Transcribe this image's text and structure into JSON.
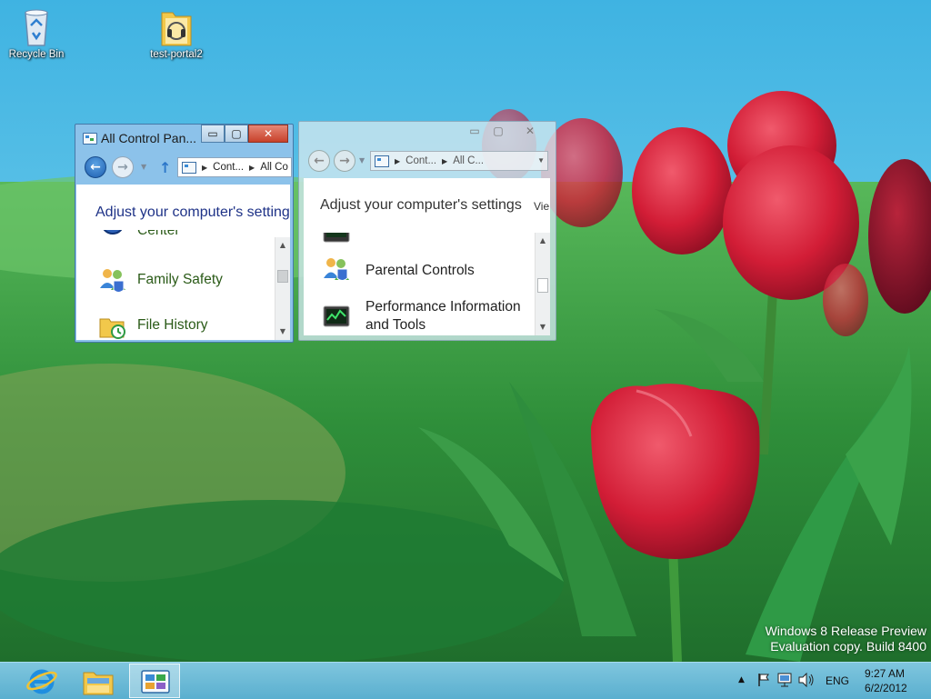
{
  "desktop": {
    "icons": [
      {
        "label": "Recycle Bin",
        "icon": "recycle-bin-icon"
      },
      {
        "label": "test-portal2",
        "icon": "folder-icon"
      }
    ],
    "watermark": {
      "line1": "Windows 8 Release Preview",
      "line2": "Evaluation copy. Build 8400"
    }
  },
  "window_left": {
    "title": "All Control Pan...",
    "state": "active",
    "caption_buttons": {
      "minimize": "▭",
      "maximize": "▢",
      "close": "✕"
    },
    "nav": {
      "back": "←",
      "forward": "→",
      "history": "▼",
      "up": "↑"
    },
    "address": {
      "crumb1": "Cont...",
      "crumb2": "All Co",
      "sep": "▶"
    },
    "heading": "Adjust your computer's setting",
    "items": [
      {
        "label": "Center",
        "icon": "action-center-icon"
      },
      {
        "label": "Family Safety",
        "icon": "family-safety-icon"
      },
      {
        "label": "File History",
        "icon": "file-history-icon"
      }
    ],
    "scroll": {
      "up": "▲",
      "down": "▼"
    }
  },
  "window_right": {
    "title": "",
    "state": "inactive",
    "caption_buttons": {
      "minimize": "▭",
      "maximize": "▢",
      "close": "✕"
    },
    "nav": {
      "back": "←",
      "forward": "→",
      "history": "▼"
    },
    "address": {
      "crumb1": "Cont...",
      "crumb2": "All C...",
      "sep": "▶",
      "dropdown": "▼"
    },
    "heading": "Adjust your computer's settings",
    "view_label": "Vie",
    "items": [
      {
        "label": "",
        "icon": "performance-monitor-icon"
      },
      {
        "label": "Parental Controls",
        "icon": "parental-controls-icon"
      },
      {
        "label_line1": "Performance Information",
        "label_line2": "and Tools",
        "icon": "performance-info-icon"
      }
    ],
    "scroll": {
      "up": "▲",
      "down": "▼"
    }
  },
  "taskbar": {
    "pinned": [
      {
        "name": "Internet Explorer",
        "icon": "internet-explorer-icon"
      },
      {
        "name": "File Explorer",
        "icon": "file-explorer-icon"
      },
      {
        "name": "Control Panel",
        "icon": "control-panel-icon",
        "active": true
      }
    ],
    "tray": {
      "chevron": "▲",
      "language": "ENG",
      "time": "9:27 AM",
      "date": "6/2/2012"
    }
  },
  "colors": {
    "sky": "#5fc6e8",
    "grass": "#2f9a44",
    "tulip": "#d8223a",
    "taskbar": "#6cbad6",
    "window_active": "#8cc2ea",
    "heading_blue": "#1e3287",
    "item_green": "#2a5a17"
  }
}
